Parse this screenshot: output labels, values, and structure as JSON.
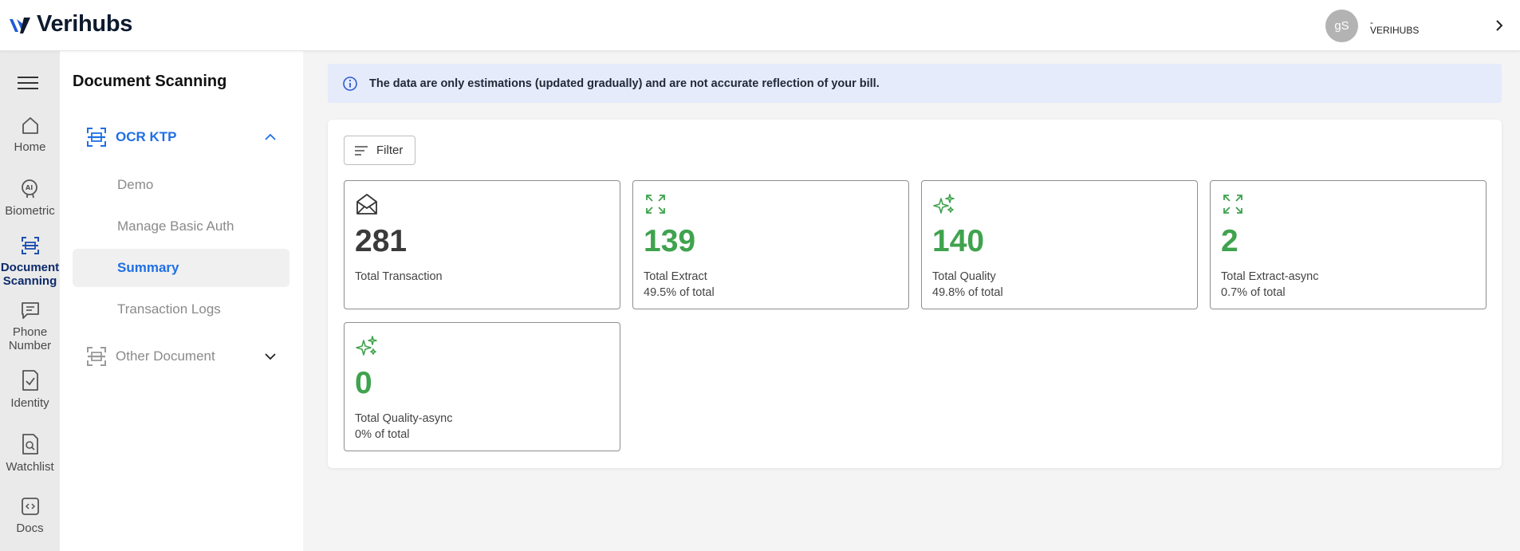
{
  "app": {
    "name": "Verihubs"
  },
  "user": {
    "initials": "gS",
    "line1": "-",
    "org": "VERIHUBS"
  },
  "rail": [
    {
      "label": "Home",
      "icon": "home-icon"
    },
    {
      "label": "Biometric",
      "icon": "ai-face-icon"
    },
    {
      "label": "Document Scanning",
      "icon": "document-scan-icon",
      "active": true
    },
    {
      "label": "Phone Number",
      "icon": "message-icon"
    },
    {
      "label": "Identity",
      "icon": "identity-check-icon"
    },
    {
      "label": "Watchlist",
      "icon": "document-search-icon"
    },
    {
      "label": "Docs",
      "icon": "code-icon"
    }
  ],
  "sidebar": {
    "title": "Document Scanning",
    "groups": [
      {
        "label": "OCR KTP",
        "expanded": true,
        "items": [
          "Demo",
          "Manage Basic Auth",
          "Summary",
          "Transaction Logs"
        ],
        "active_item": "Summary"
      },
      {
        "label": "Other Document",
        "expanded": false
      }
    ]
  },
  "alert": {
    "message": "The data are only estimations (updated gradually) and are not accurate reflection of your bill."
  },
  "filter": {
    "label": "Filter"
  },
  "cards": [
    {
      "value": "281",
      "label": "Total Transaction",
      "pct": "",
      "icon": "envelope-open-icon"
    },
    {
      "value": "139",
      "label": "Total Extract",
      "pct": "49.5% of total",
      "icon": "expand-arrows-icon"
    },
    {
      "value": "140",
      "label": "Total Quality",
      "pct": "49.8% of total",
      "icon": "sparkles-icon"
    },
    {
      "value": "2",
      "label": "Total Extract-async",
      "pct": "0.7% of total",
      "icon": "expand-arrows-icon"
    },
    {
      "value": "0",
      "label": "Total Quality-async",
      "pct": "0% of total",
      "icon": "sparkles-icon"
    }
  ],
  "colors": {
    "accent_blue": "#1f6fe5",
    "green": "#3fa34d",
    "navy": "#0d2a6b",
    "alert_bg": "#e5ebfb"
  }
}
